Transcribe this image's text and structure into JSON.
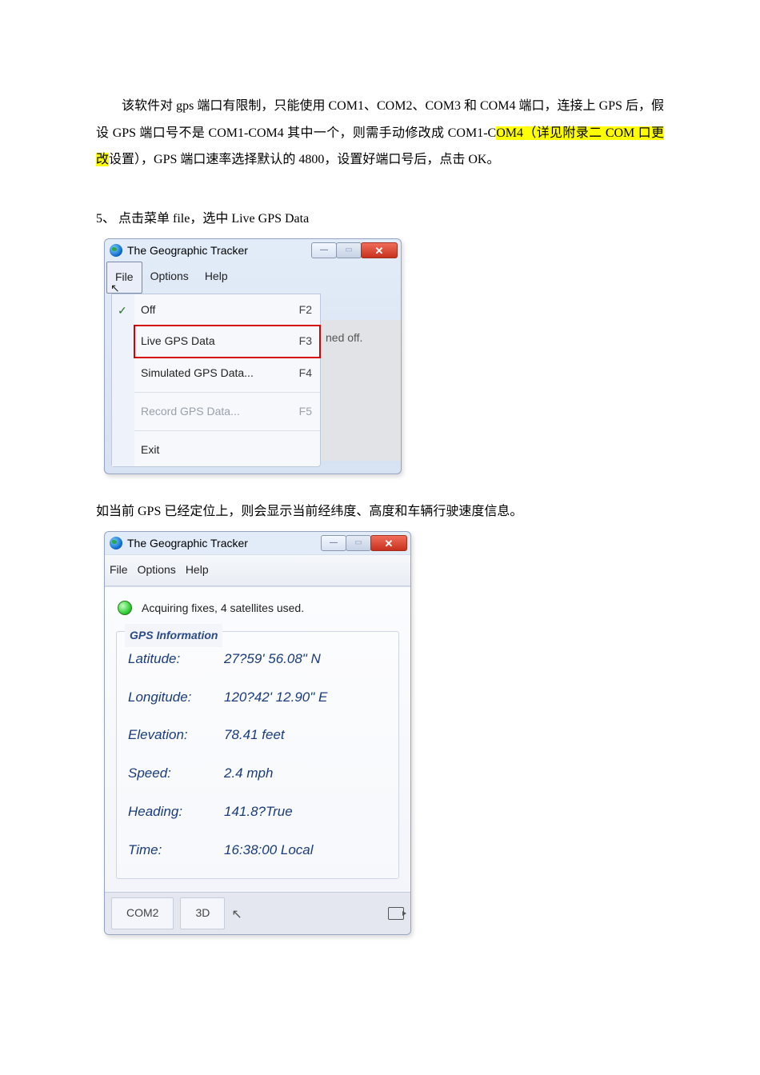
{
  "body": {
    "para1_a": "该软件对 gps 端口有限制，只能使用 COM1、COM2、COM3 和 COM4 端口，连接上 GPS 后，假设 GPS 端口号不是 COM1-COM4 其中一个，则需手动修改成 COM1-C",
    "para1_hl": "OM4（详见附录二 COM 口更改",
    "para1_b": "设置），GPS 端口速率选择默认的 4800，设置好端口号后，点击 OK。",
    "step5": "5、 点击菜单 file，选中 Live GPS Data",
    "note2": "如当前 GPS 已经定位上，则会显示当前经纬度、高度和车辆行驶速度信息。"
  },
  "win1": {
    "title": "The Geographic Tracker",
    "menus": {
      "file": "File",
      "options": "Options",
      "help": "Help"
    },
    "right_text": "ned off.",
    "items": [
      {
        "label": "Off",
        "shortcut": "F2"
      },
      {
        "label": "Live GPS Data",
        "shortcut": "F3"
      },
      {
        "label": "Simulated GPS Data...",
        "shortcut": "F4"
      },
      {
        "label": "Record GPS Data...",
        "shortcut": "F5"
      },
      {
        "label": "Exit",
        "shortcut": ""
      }
    ]
  },
  "win2": {
    "title": "The Geographic Tracker",
    "menus": {
      "file": "File",
      "options": "Options",
      "help": "Help"
    },
    "status": "Acquiring fixes, 4 satellites used.",
    "group_title": "GPS Information",
    "fields": {
      "latitude": {
        "k": "Latitude:",
        "v": "27?59' 56.08\" N"
      },
      "longitude": {
        "k": "Longitude:",
        "v": "120?42' 12.90\" E"
      },
      "elevation": {
        "k": "Elevation:",
        "v": "78.41 feet"
      },
      "speed": {
        "k": "Speed:",
        "v": "2.4 mph"
      },
      "heading": {
        "k": "Heading:",
        "v": "141.8?True"
      },
      "time": {
        "k": "Time:",
        "v": "16:38:00 Local"
      }
    },
    "statusbar": {
      "com": "COM2",
      "mode": "3D"
    }
  }
}
